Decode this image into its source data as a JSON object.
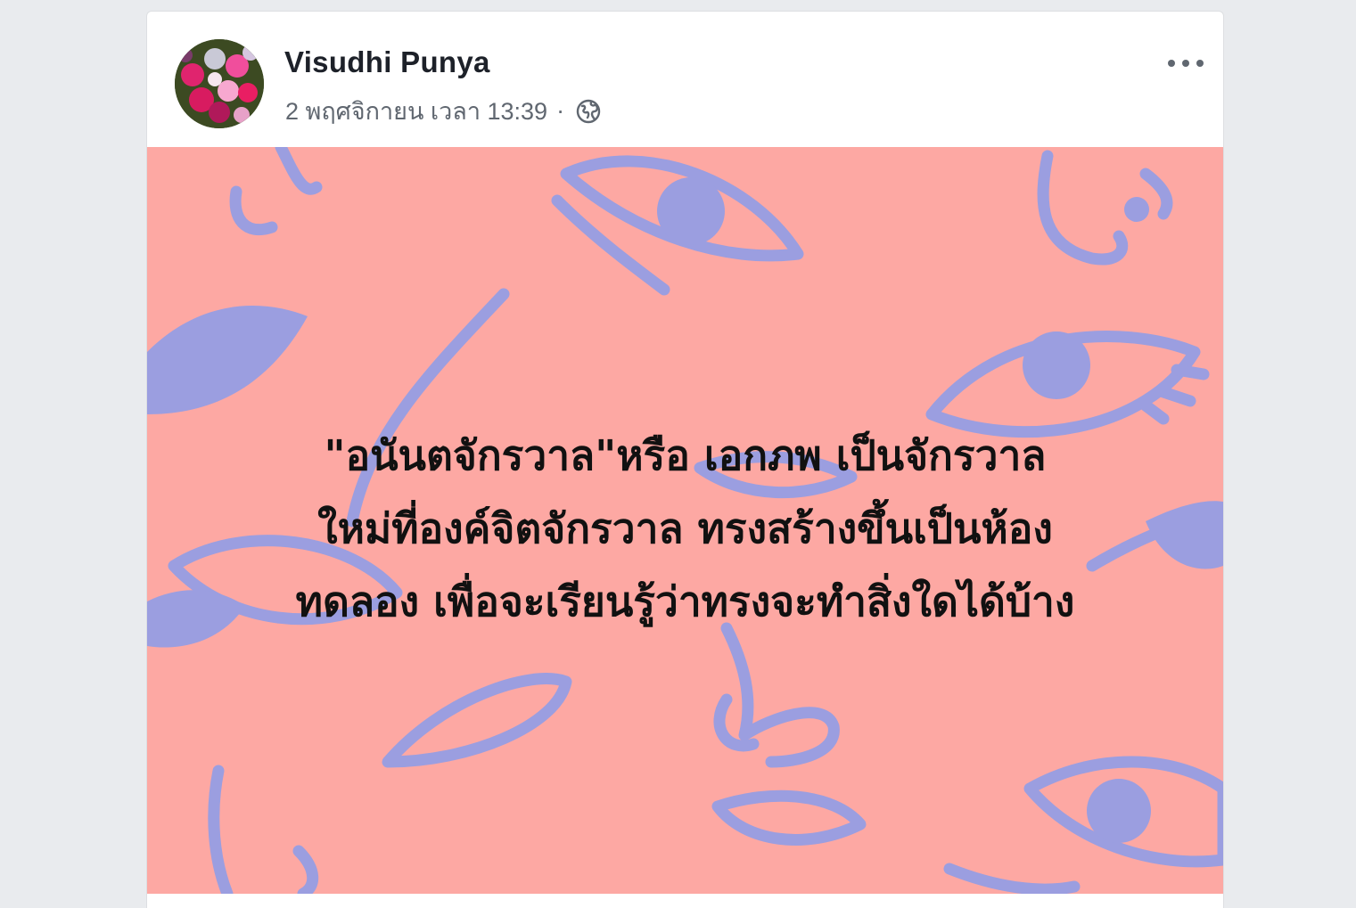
{
  "post": {
    "author": "Visudhi Punya",
    "timestamp": "2 พฤศจิกายน เวลา 13:39",
    "separator": "·",
    "privacy_icon": "globe-icon",
    "more_icon": "more-options-icon",
    "image": {
      "background_color": "#fda8a3",
      "pattern_color": "#9b9ee0",
      "text_lines": [
        "\"อนันตจักรวาล\"หรือ เอกภพ เป็นจักรวาล",
        "ใหม่ที่องค์จิตจักรวาล ทรงสร้างขึ้นเป็นห้อง",
        "ทดลอง เพื่อจะเรียนรู้ว่าทรงจะทำสิ่งใดได้บ้าง"
      ]
    }
  }
}
